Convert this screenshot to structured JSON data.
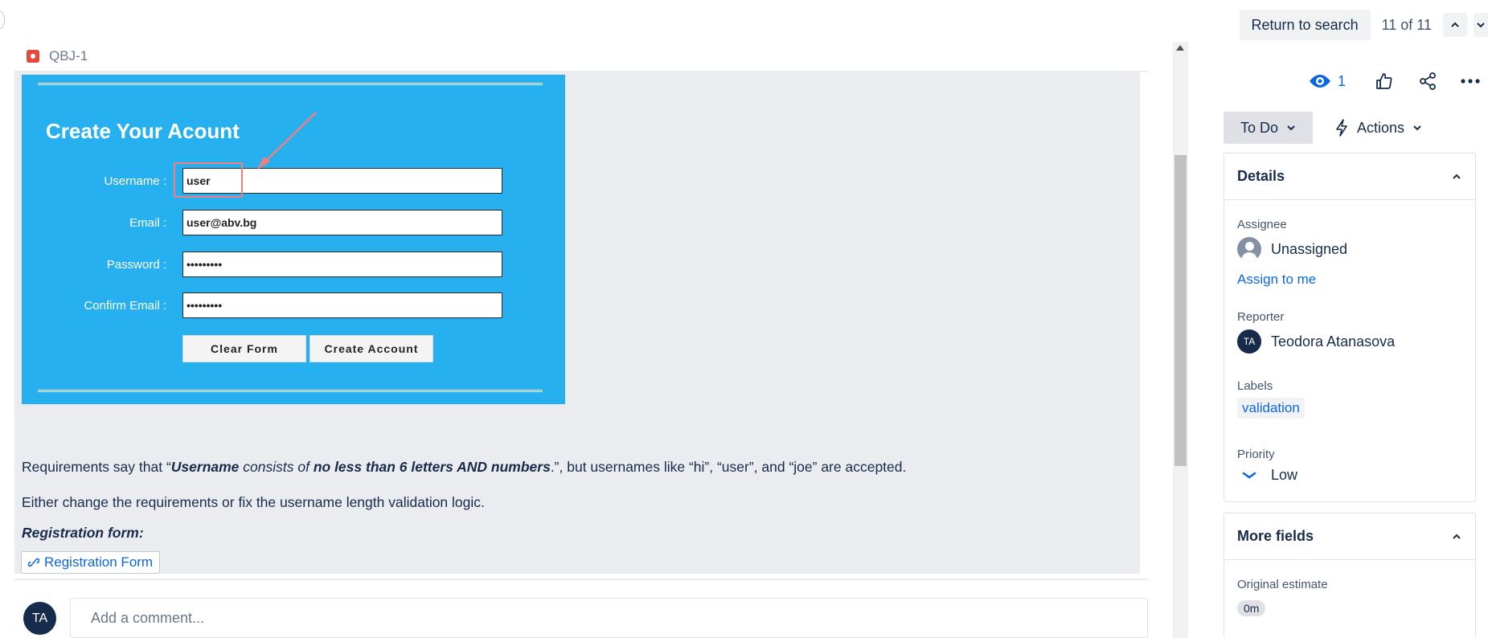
{
  "nav": {
    "return_label": "Return to search",
    "counter": "11 of 11"
  },
  "issue": {
    "key": "QBJ-1"
  },
  "screenshot": {
    "title": "Create Your Acount",
    "fields": [
      {
        "label": "Username :",
        "value": "user"
      },
      {
        "label": "Email :",
        "value": "user@abv.bg"
      },
      {
        "label": "Password :",
        "value": "•••••••••"
      },
      {
        "label": "Confirm Email :",
        "value": "•••••••••"
      }
    ],
    "clear_label": "Clear Form",
    "create_label": "Create Account"
  },
  "description": {
    "p1_pre": "Requirements say that “",
    "p1_b1": "Username",
    "p1_i1": " consists of ",
    "p1_b2": "no less than 6 letters AND numbers",
    "p1_post": ".”, but usernames like “hi”, “user”, and “joe” are accepted.",
    "p2": "Either change the requirements or fix the username length validation logic.",
    "reg_label": "Registration form:",
    "link_label": "Registration Form"
  },
  "comment": {
    "avatar": "TA",
    "placeholder": "Add a comment..."
  },
  "toolbar": {
    "watch_count": "1"
  },
  "status": {
    "label": "To Do",
    "actions_label": "Actions"
  },
  "details": {
    "title": "Details",
    "assignee_label": "Assignee",
    "assignee_value": "Unassigned",
    "assign_to_me": "Assign to me",
    "reporter_label": "Reporter",
    "reporter_initials": "TA",
    "reporter_value": "Teodora Atanasova",
    "labels_label": "Labels",
    "label_value": "validation",
    "priority_label": "Priority",
    "priority_value": "Low"
  },
  "more_fields": {
    "title": "More fields",
    "estimate_label": "Original estimate",
    "estimate_value": "0m"
  },
  "colors": {
    "link": "#0c66e4",
    "screenshot_bg": "#26b0f0",
    "annotation": "#f08080"
  }
}
